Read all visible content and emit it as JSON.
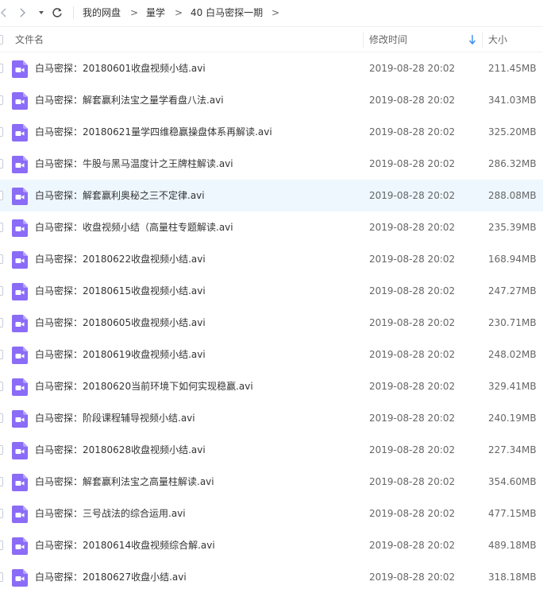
{
  "breadcrumb": {
    "items": [
      "我的网盘",
      "量学",
      "40 白马密探一期"
    ],
    "separator": ">"
  },
  "columns": {
    "name": "文件名",
    "modified": "修改时间",
    "size": "大小"
  },
  "colors": {
    "icon_purple": "#8a6cf7",
    "hover_row": "#eef7fe",
    "sort_arrow": "#3b8cf0"
  },
  "icons": {
    "back": "chevron-left-icon",
    "forward": "chevron-right-icon",
    "history": "triangle-down-icon",
    "refresh": "refresh-icon",
    "sort": "sort-down-icon",
    "file": "video-file-icon"
  },
  "files": [
    {
      "name": "白马密探：20180601收盘视频小结.avi",
      "modified": "2019-08-28 20:02",
      "size": "211.45MB"
    },
    {
      "name": "白马密探：解套赢利法宝之量学看盘八法.avi",
      "modified": "2019-08-28 20:02",
      "size": "341.03MB"
    },
    {
      "name": "白马密探：20180621量学四维稳赢操盘体系再解读.avi",
      "modified": "2019-08-28 20:02",
      "size": "325.20MB"
    },
    {
      "name": "白马密探：牛股与黑马温度计之王牌柱解读.avi",
      "modified": "2019-08-28 20:02",
      "size": "286.32MB"
    },
    {
      "name": "白马密探：解套赢利奥秘之三不定律.avi",
      "modified": "2019-08-28 20:02",
      "size": "288.08MB"
    },
    {
      "name": "白马密探：收盘视频小结（高量柱专题解读.avi",
      "modified": "2019-08-28 20:02",
      "size": "235.39MB"
    },
    {
      "name": "白马密探：20180622收盘视频小结.avi",
      "modified": "2019-08-28 20:02",
      "size": "168.94MB"
    },
    {
      "name": "白马密探：20180615收盘视频小结.avi",
      "modified": "2019-08-28 20:02",
      "size": "247.27MB"
    },
    {
      "name": "白马密探：20180605收盘视频小结.avi",
      "modified": "2019-08-28 20:02",
      "size": "230.71MB"
    },
    {
      "name": "白马密探：20180619收盘视频小结.avi",
      "modified": "2019-08-28 20:02",
      "size": "248.02MB"
    },
    {
      "name": "白马密探：20180620当前环境下如何实现稳赢.avi",
      "modified": "2019-08-28 20:02",
      "size": "329.41MB"
    },
    {
      "name": "白马密探：阶段课程辅导视频小结.avi",
      "modified": "2019-08-28 20:02",
      "size": "240.19MB"
    },
    {
      "name": "白马密探：20180628收盘视频小结.avi",
      "modified": "2019-08-28 20:02",
      "size": "227.34MB"
    },
    {
      "name": "白马密探：解套赢利法宝之高量柱解读.avi",
      "modified": "2019-08-28 20:02",
      "size": "354.60MB"
    },
    {
      "name": "白马密探：三号战法的综合运用.avi",
      "modified": "2019-08-28 20:02",
      "size": "477.15MB"
    },
    {
      "name": "白马密探：20180614收盘视频综合解.avi",
      "modified": "2019-08-28 20:02",
      "size": "489.18MB"
    },
    {
      "name": "白马密探：20180627收盘小结.avi",
      "modified": "2019-08-28 20:02",
      "size": "318.18MB"
    }
  ],
  "hover_index": 4
}
